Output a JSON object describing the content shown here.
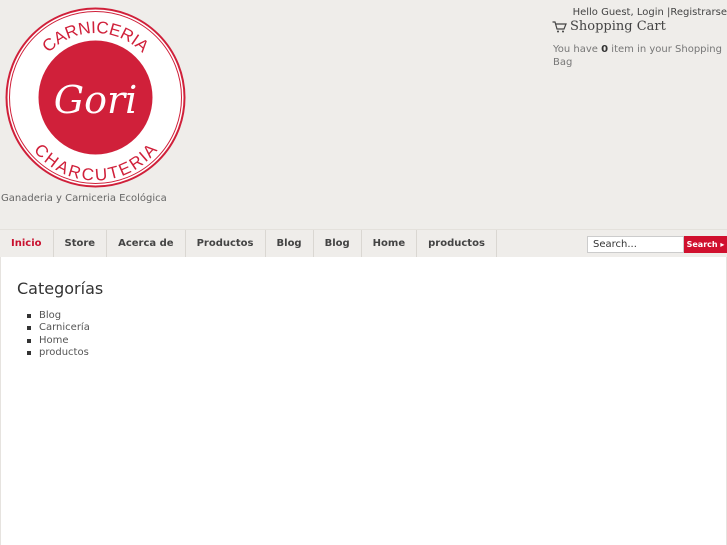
{
  "logo": {
    "top_text": "CARNICERIA",
    "brand": "Gori",
    "bottom_text": "CHARCUTERIA",
    "colors": {
      "red": "#d0203a",
      "white": "#ffffff"
    }
  },
  "tagline": "Ganaderia y Carniceria Ecológica",
  "header": {
    "greeting": "Hello Guest,",
    "login": "Login",
    "separator": "|",
    "register": "Registrarse"
  },
  "cart": {
    "icon": "cart-icon",
    "title": "Shopping Cart",
    "msg_prefix": "You have",
    "count": "0",
    "msg_suffix": "item in your Shopping Bag"
  },
  "nav": {
    "items": [
      {
        "label": "Inicio",
        "active": true
      },
      {
        "label": "Store"
      },
      {
        "label": "Acerca de"
      },
      {
        "label": "Productos"
      },
      {
        "label": "Blog"
      },
      {
        "label": "Blog"
      },
      {
        "label": "Home"
      },
      {
        "label": "productos"
      }
    ]
  },
  "search": {
    "placeholder": "Search...",
    "button_label": "Search ▸"
  },
  "categories": {
    "title": "Categorías",
    "items": [
      "Blog",
      "Carnicería",
      "Home",
      "productos"
    ]
  },
  "colors": {
    "accent": "#c8102e",
    "background": "#efedea"
  }
}
